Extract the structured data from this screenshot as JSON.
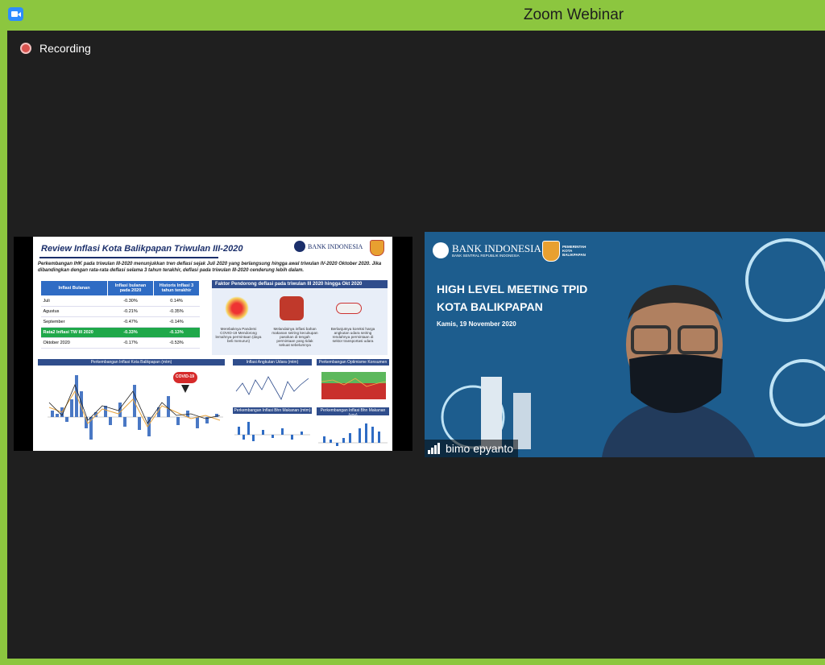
{
  "window": {
    "title": "Zoom Webinar"
  },
  "recording": {
    "label": "Recording"
  },
  "slide": {
    "title": "Review Inflasi Kota Balikpapan Triwulan III-2020",
    "logo_text": "BANK INDONESIA",
    "description": "Perkembangan IHK pada triwulan III-2020 menunjukkan tren deflasi sejak Juli 2020 yang berlangsung hingga awal triwulan IV-2020 Oktober 2020. Jika dibandingkan dengan rata-rata deflasi selama 3 tahun terakhir, deflasi pada triwulan III-2020 cenderung lebih dalam.",
    "table": {
      "headers": [
        "Inflasi Bulanan",
        "Inflasi bulanan pada 2020",
        "Historis Inflasi 3 tahun terakhir"
      ],
      "rows": [
        [
          "Juli",
          "-0.30%",
          "0.14%"
        ],
        [
          "Agustus",
          "-0.21%",
          "-0.35%"
        ],
        [
          "September",
          "-0.47%",
          "-0.14%"
        ],
        [
          "Rata2 Inflasi TW III 2020",
          "-0.33%",
          "-0.13%"
        ],
        [
          "Oktober 2020",
          "-0.17%",
          "-0.53%"
        ]
      ]
    },
    "factors": {
      "heading": "Faktor Pendorong deflasi pada triwulan III 2020 hingga Okt 2020",
      "items": [
        "Merebaknya Pandemi COVID-19 Mendorong lemahnya permintaan (daya beli menurun)",
        "Melandainya inflasi bahan makanan seiring kecukupan pasokan di tengah permintaan yang tidak sekuat sebelumnya",
        "Berlanjutnya koreksi harga angkutan udara seiring rendahnya permintaan di sektor transportasi udara"
      ]
    },
    "charts": {
      "main": "Perkembangan Inflasi Kota Balikpapan (mtm)",
      "air": "Inflasi Angkutan Udara (mtm)",
      "consumer": "Perkembangan Optimisme Konsumen",
      "nonfood": "Perkembangan Inflasi Bhn Makanan (mtm)",
      "food_yoy": "Perkembangan Inflasi Bhn Makanan (yoy)",
      "covid_label": "COVID-19"
    }
  },
  "speaker": {
    "name": "bimo epyanto",
    "logo_text": "BANK INDONESIA",
    "logo_sub": "BANK SENTRAL REPUBLIK INDONESIA",
    "crest_text": "PEMERINTAH KOTA BALIKPAPAN",
    "title_line1": "HIGH LEVEL MEETING TPID",
    "title_line2": "KOTA BALIKPAPAN",
    "date": "Kamis, 19 November 2020"
  }
}
